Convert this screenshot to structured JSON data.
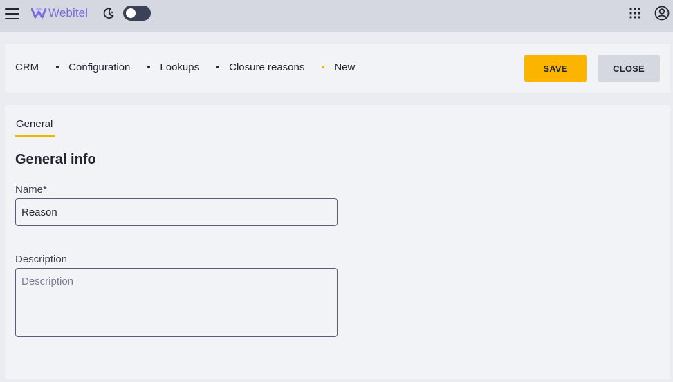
{
  "appbar": {
    "logo_text": "Webitel",
    "brand_color": "#7a6be0",
    "theme_toggle": {
      "state": "off",
      "icon": "moon-icon"
    },
    "right_icons": [
      "apps-grid-icon",
      "account-icon"
    ]
  },
  "header": {
    "breadcrumb": [
      {
        "label": "CRM"
      },
      {
        "label": "Configuration"
      },
      {
        "label": "Lookups"
      },
      {
        "label": "Closure reasons"
      },
      {
        "label": "New"
      }
    ],
    "save_label": "SAVE",
    "close_label": "CLOSE",
    "accent_color": "#fbb500"
  },
  "main": {
    "tabs": [
      {
        "label": "General",
        "active": true
      }
    ],
    "section_title": "General info",
    "fields": {
      "name": {
        "label": "Name*",
        "value": "Reason"
      },
      "description": {
        "label": "Description",
        "placeholder": "Description",
        "value": ""
      }
    }
  }
}
